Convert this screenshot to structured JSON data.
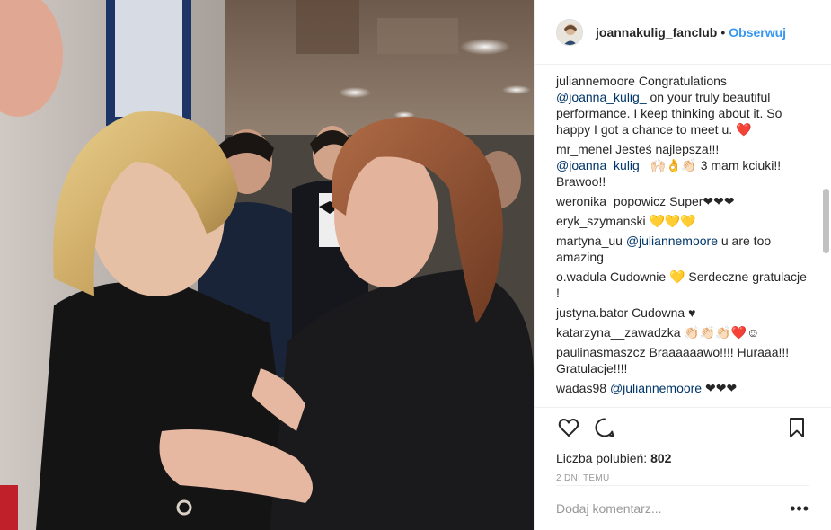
{
  "post": {
    "author": "joannakulig_fanclub",
    "separator": "•",
    "follow_label": "Obserwuj",
    "likes_label": "Liczba polubień:",
    "likes_count": "802",
    "timestamp": "2 DNI TEMU",
    "comment_placeholder": "Dodaj komentarz...",
    "more_label": "•••"
  },
  "comments": [
    {
      "user": "juliannemoore",
      "pre": "Congratulations ",
      "mention": "@joanna_kulig_",
      "post": " on your truly beautiful performance. I keep thinking about it. So happy I got a chance to meet u. ❤️"
    },
    {
      "user": "mr_menel",
      "pre": "Jesteś najlepsza!!! ",
      "mention": "@joanna_kulig_",
      "post": " 🙌🏻👌👏🏻 3 mam kciuki!! Brawoo!!"
    },
    {
      "user": "weronika_popowicz",
      "pre": "Super❤❤❤",
      "mention": "",
      "post": ""
    },
    {
      "user": "eryk_szymanski",
      "pre": "💛💛💛",
      "mention": "",
      "post": ""
    },
    {
      "user": "martyna_uu",
      "pre": "",
      "mention": "@juliannemoore",
      "post": " u are too amazing"
    },
    {
      "user": "o.wadula",
      "pre": "Cudownie 💛 Serdeczne gratulacje !",
      "mention": "",
      "post": ""
    },
    {
      "user": "justyna.bator",
      "pre": "Cudowna ♥",
      "mention": "",
      "post": ""
    },
    {
      "user": "katarzyna__zawadzka",
      "pre": "👏🏻👏🏻👏🏻❤️☺",
      "mention": "",
      "post": ""
    },
    {
      "user": "paulinasmaszcz",
      "pre": "Braaaaaawo!!!! Huraaa!!! Gratulacje!!!!",
      "mention": "",
      "post": ""
    },
    {
      "user": "wadas98",
      "pre": "",
      "mention": "@juliannemoore",
      "post": " ❤❤❤"
    }
  ],
  "icons": {
    "heart": "heart-icon",
    "comment": "comment-icon",
    "bookmark": "bookmark-icon",
    "avatar": "avatar"
  },
  "colors": {
    "accent": "#3897f0",
    "mention": "#003569",
    "muted": "#999999"
  }
}
